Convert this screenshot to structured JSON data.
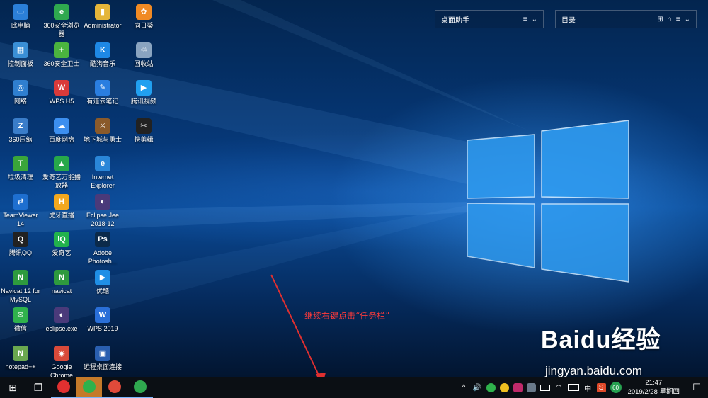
{
  "desktop_icons": [
    {
      "name": "pc",
      "label": "此电脑",
      "glyph": "▭",
      "color": "#2b7fd8"
    },
    {
      "name": "360-browser",
      "label": "360安全浏览器",
      "glyph": "e",
      "color": "#2fa84f"
    },
    {
      "name": "administrator",
      "label": "Administrator",
      "glyph": "▮",
      "color": "#e4b53a"
    },
    {
      "name": "sunflower",
      "label": "向日葵",
      "glyph": "✿",
      "color": "#f08a24"
    },
    {
      "name": "control-panel",
      "label": "控制面板",
      "glyph": "▦",
      "color": "#3a8fd6"
    },
    {
      "name": "360-safe",
      "label": "360安全卫士",
      "glyph": "+",
      "color": "#4bb43f"
    },
    {
      "name": "kugou",
      "label": "酷狗音乐",
      "glyph": "K",
      "color": "#1e88e5"
    },
    {
      "name": "recycle-bin",
      "label": "回收站",
      "glyph": "♲",
      "color": "#8aa4c0"
    },
    {
      "name": "network",
      "label": "网络",
      "glyph": "◎",
      "color": "#2f7fd0"
    },
    {
      "name": "wps-h5",
      "label": "WPS H5",
      "glyph": "W",
      "color": "#d93a3a"
    },
    {
      "name": "youdao-note",
      "label": "有道云笔记",
      "glyph": "✎",
      "color": "#2a7ee0"
    },
    {
      "name": "tencent-video",
      "label": "腾讯视频",
      "glyph": "▶",
      "color": "#21a0f0"
    },
    {
      "name": "360-zip",
      "label": "360压缩",
      "glyph": "Z",
      "color": "#3a7dc9"
    },
    {
      "name": "baidu-pan",
      "label": "百度网盘",
      "glyph": "☁",
      "color": "#3c8ff0"
    },
    {
      "name": "dnf",
      "label": "地下城与勇士",
      "glyph": "⚔",
      "color": "#8a5a2a"
    },
    {
      "name": "kuaijian",
      "label": "快剪辑",
      "glyph": "✂",
      "color": "#222222"
    },
    {
      "name": "trash-clean",
      "label": "垃圾清理",
      "glyph": "T",
      "color": "#3aa53a"
    },
    {
      "name": "iqiyi-player",
      "label": "爱奇艺万能播放器",
      "glyph": "▲",
      "color": "#27a84a"
    },
    {
      "name": "ie",
      "label": "Internet Explorer",
      "glyph": "e",
      "color": "#2a86d8"
    },
    {
      "name": "empty-1",
      "label": "",
      "glyph": "",
      "color": ""
    },
    {
      "name": "teamviewer",
      "label": "TeamViewer 14",
      "glyph": "⇄",
      "color": "#1e6fd0"
    },
    {
      "name": "huya",
      "label": "虎牙直播",
      "glyph": "H",
      "color": "#f3a81f"
    },
    {
      "name": "eclipse-jee",
      "label": "Eclipse Jee 2018-12",
      "glyph": "◐",
      "color": "#4a3a7a"
    },
    {
      "name": "empty-2",
      "label": "",
      "glyph": "",
      "color": ""
    },
    {
      "name": "qq",
      "label": "腾讯QQ",
      "glyph": "Q",
      "color": "#222222"
    },
    {
      "name": "iqiyi",
      "label": "爱奇艺",
      "glyph": "iQ",
      "color": "#22b24c"
    },
    {
      "name": "photoshop",
      "label": "Adobe Photosh...",
      "glyph": "Ps",
      "color": "#0b2a4a"
    },
    {
      "name": "empty-3",
      "label": "",
      "glyph": "",
      "color": ""
    },
    {
      "name": "navicat-mysql",
      "label": "Navicat 12 for MySQL",
      "glyph": "N",
      "color": "#2e9a3e"
    },
    {
      "name": "navicat",
      "label": "navicat",
      "glyph": "N",
      "color": "#2e9a3e"
    },
    {
      "name": "youku",
      "label": "优酷",
      "glyph": "▶",
      "color": "#1f8fe6"
    },
    {
      "name": "empty-4",
      "label": "",
      "glyph": "",
      "color": ""
    },
    {
      "name": "wechat",
      "label": "微信",
      "glyph": "✉",
      "color": "#2fb24c"
    },
    {
      "name": "eclipse-exe",
      "label": "eclipse.exe",
      "glyph": "◐",
      "color": "#4a3a7a"
    },
    {
      "name": "wps-2019",
      "label": "WPS 2019",
      "glyph": "W",
      "color": "#2a6fd8"
    },
    {
      "name": "empty-5",
      "label": "",
      "glyph": "",
      "color": ""
    },
    {
      "name": "notepadpp",
      "label": "notepad++",
      "glyph": "N",
      "color": "#6aa84f"
    },
    {
      "name": "chrome",
      "label": "Google Chrome",
      "glyph": "◉",
      "color": "#d94a3a"
    },
    {
      "name": "remote-desktop",
      "label": "远程桌面连接",
      "glyph": "▣",
      "color": "#2a5fb0"
    },
    {
      "name": "empty-6",
      "label": "",
      "glyph": "",
      "color": ""
    }
  ],
  "widgets": {
    "assistant_title": "桌面助手",
    "assistant_menu_icon": "≡",
    "assistant_chevron": "⌄",
    "catalog_title": "目录",
    "catalog_grid_icon": "⊞",
    "catalog_lock_icon": "⌂",
    "catalog_menu_icon": "≡",
    "catalog_chevron": "⌄"
  },
  "annotation": {
    "text": "继续右键点击“任务栏”",
    "color": "#ff3b3b"
  },
  "watermark": {
    "logo": "Baidu经验",
    "url": "jingyan.baidu.com"
  },
  "taskbar": {
    "start_icon": "⊞",
    "task_view_icon": "❐",
    "apps": [
      {
        "name": "qq",
        "color": "#e03030",
        "active": false
      },
      {
        "name": "wechat",
        "color": "#2fb24c",
        "active": true
      },
      {
        "name": "chrome",
        "color": "#e04a3a",
        "active": false
      },
      {
        "name": "360-browser",
        "color": "#2fa84f",
        "active": false
      }
    ],
    "tray": {
      "chevron": "^",
      "volume": "🔊",
      "ime_lang": "中",
      "badge_value": "60"
    },
    "clock": {
      "time": "21:47",
      "date": "2019/2/28 星期四"
    },
    "notification_icon": "☐"
  }
}
